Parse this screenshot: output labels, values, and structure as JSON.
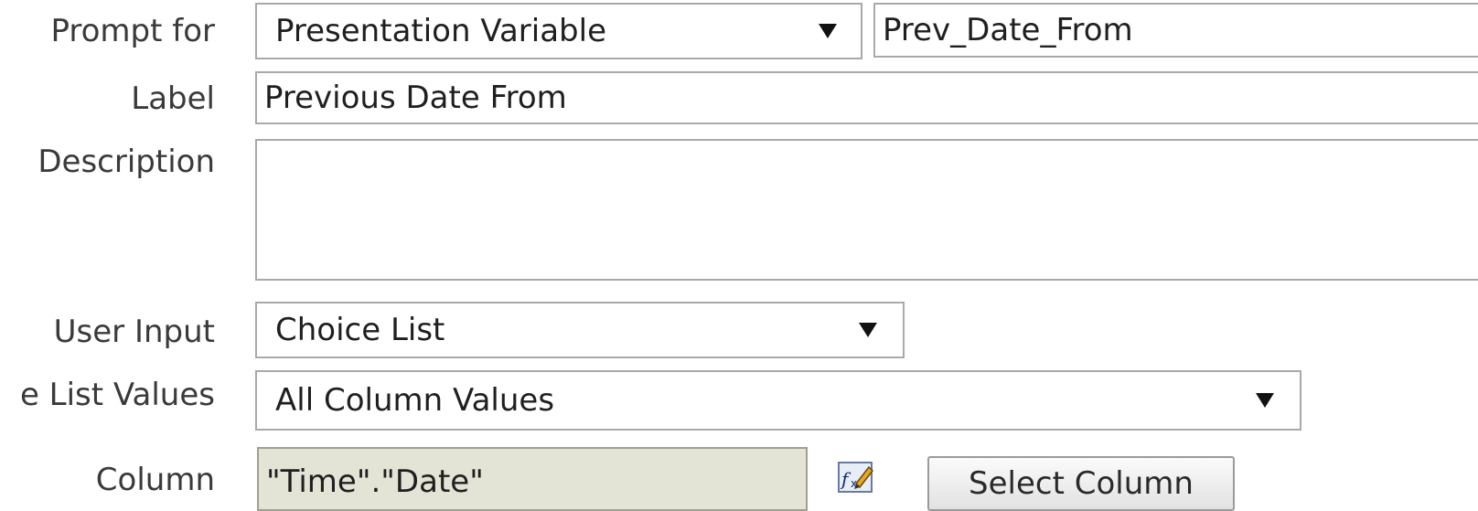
{
  "form": {
    "prompt_for": {
      "label": "Prompt for",
      "type_value": "Presentation Variable",
      "name_value": "Prev_Date_From"
    },
    "label_row": {
      "label": "Label",
      "value": "Previous Date From"
    },
    "description": {
      "label": "Description",
      "value": ""
    },
    "user_input": {
      "label": "User Input",
      "value": "Choice List"
    },
    "list_values": {
      "label": "e List Values",
      "value": "All Column Values"
    },
    "column": {
      "label": "Column",
      "value": "\"Time\".\"Date\"",
      "formula_icon": "edit-formula-icon",
      "select_button_label": "Select Column"
    }
  }
}
